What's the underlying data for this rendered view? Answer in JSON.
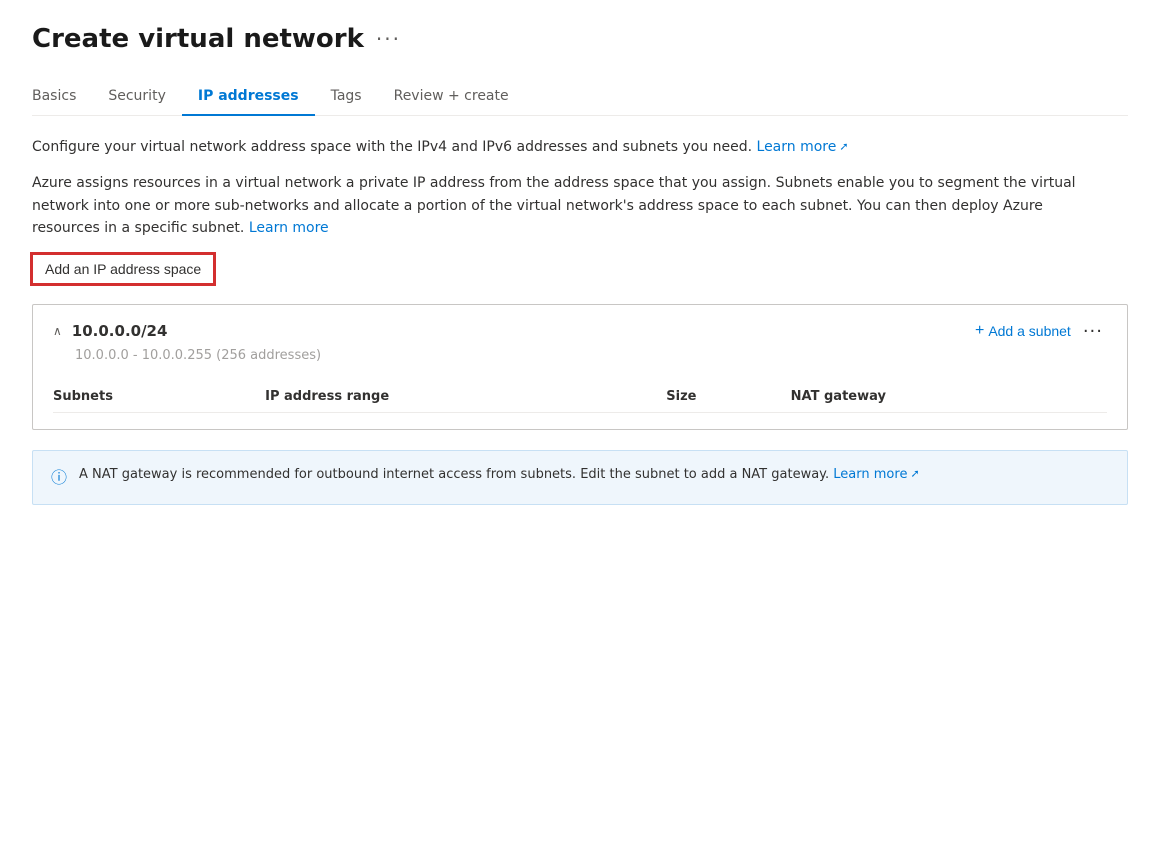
{
  "page": {
    "title": "Create virtual network",
    "more_label": "···"
  },
  "tabs": [
    {
      "id": "basics",
      "label": "Basics",
      "active": false
    },
    {
      "id": "security",
      "label": "Security",
      "active": false
    },
    {
      "id": "ip-addresses",
      "label": "IP addresses",
      "active": true
    },
    {
      "id": "tags",
      "label": "Tags",
      "active": false
    },
    {
      "id": "review-create",
      "label": "Review + create",
      "active": false
    }
  ],
  "descriptions": {
    "line1": "Configure your virtual network address space with the IPv4 and IPv6 addresses and subnets you need.",
    "line1_link": "Learn more",
    "line2": "Azure assigns resources in a virtual network a private IP address from the address space that you assign. Subnets enable you to segment the virtual network into one or more sub-networks and allocate a portion of the virtual network's address space to each subnet. You can then deploy Azure resources in a specific subnet.",
    "line2_link": "Learn more"
  },
  "add_ip_button": "Add an IP address space",
  "ip_space": {
    "cidr": "10.0.0.0/24",
    "range_text": "10.0.0.0 - 10.0.0.255 (256 addresses)",
    "add_subnet_label": "Add a subnet",
    "more_options_label": "···",
    "table": {
      "columns": [
        "Subnets",
        "IP address range",
        "Size",
        "NAT gateway"
      ],
      "rows": []
    }
  },
  "info_banner": {
    "text": "A NAT gateway is recommended for outbound internet access from subnets. Edit the subnet to add a NAT gateway.",
    "link_text": "Learn more"
  }
}
